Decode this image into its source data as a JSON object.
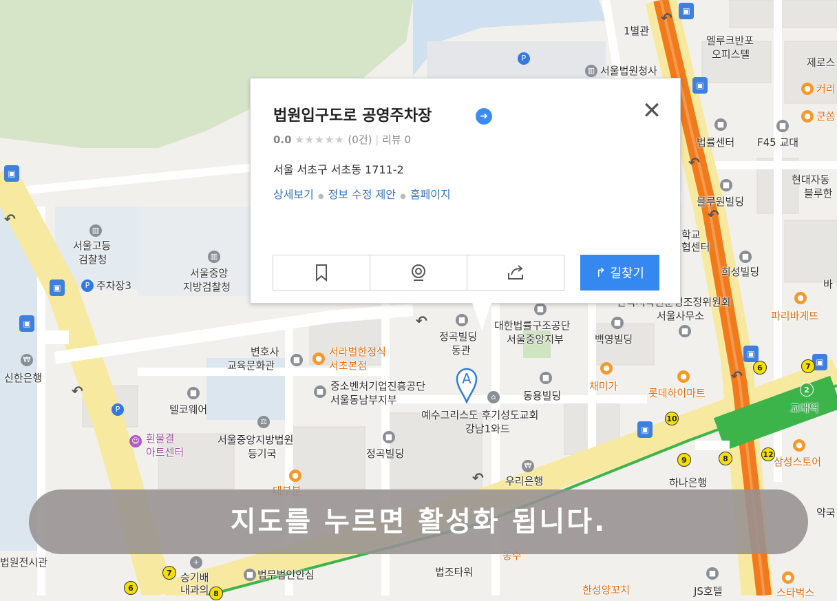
{
  "popup": {
    "title": "법원입구도로 공영주차장",
    "score": "0.0",
    "stars": "★★★★★",
    "count": "(0건)",
    "review": "리뷰 0",
    "address": "서울 서초구 서초동 1711-2",
    "links": [
      "상세보기",
      "정보 수정 제안",
      "홈페이지"
    ],
    "route_label": "길찾기"
  },
  "banner": "지도를 누르면 활성화 됩니다.",
  "pin_letter": "A",
  "map_labels": {
    "byeolgwan": "1별관",
    "elluke1": "엘루크반포",
    "elluke2": "오피스텔",
    "jero": "제로스",
    "court": "서울법원청사",
    "curry": "커리",
    "kun": "쿤쏨",
    "law_center": "법률센터",
    "f45": "F45 교대",
    "hyundai1": "현대자동",
    "hyundai2": "블루한",
    "blue": "블루원빌딩",
    "school1": "학교",
    "school2": "협센터",
    "huisung": "희성빌딩",
    "ba": "바",
    "dispute1": "한국저작권분쟁조정위원회",
    "dispute2": "서울사무소",
    "paris": "파리바게뜨",
    "highcourt1": "서울고등",
    "highcourt2": "검찰청",
    "central1": "서울중앙",
    "central2": "지방검찰청",
    "parking3": "주차장3",
    "jeonggok1": "정곡빌딩",
    "jeonggok2": "동관",
    "legal1": "대한법률구조공단",
    "legal2": "서울중앙지부",
    "baekyoung": "백영빌딩",
    "lawyer1": "변호사",
    "lawyer2": "교육문화관",
    "serabeol1": "서라벌한정식",
    "serabeol2": "서초본점",
    "sme1": "중소벤처기업진흥공단",
    "sme2": "서울동남부지부",
    "shinhan": "신한은행",
    "telco": "텔코웨어",
    "dongyong": "동용빌딩",
    "chaemiga": "채미가",
    "lotte": "롯데하이마트",
    "gyodae": "교대역",
    "jesus1": "예수그리스도 후기성도교회",
    "jesus2": "강남1와드",
    "art1": "흰물결",
    "art2": "아트센터",
    "district1": "서울중앙지방법원",
    "district2": "등기국",
    "jeonggok3": "정곡빌딩",
    "woori": "우리은행",
    "hana": "하나은행",
    "samsung": "삼성스토어",
    "pharmacy": "약국",
    "histmuseum": "법원전시관",
    "seunggi1": "승기배",
    "seunggi2": "내과의",
    "lawfirm": "법무법인안심",
    "lawtower": "법조타워",
    "hansung": "한성양꼬치",
    "js": "JS호텔",
    "starbucks": "스타벅스",
    "dongsu": "동수",
    "dabang": "대부분"
  },
  "exit_numbers": [
    "6",
    "7",
    "10",
    "9",
    "8",
    "12",
    "7",
    "6",
    "8",
    "2"
  ],
  "colors": {
    "route_button": "#3588f0",
    "link": "#3a75c4",
    "subway_line2": "#3cb44a",
    "subway_line3": "#f07a1c",
    "road_major": "#f8e9a0"
  }
}
